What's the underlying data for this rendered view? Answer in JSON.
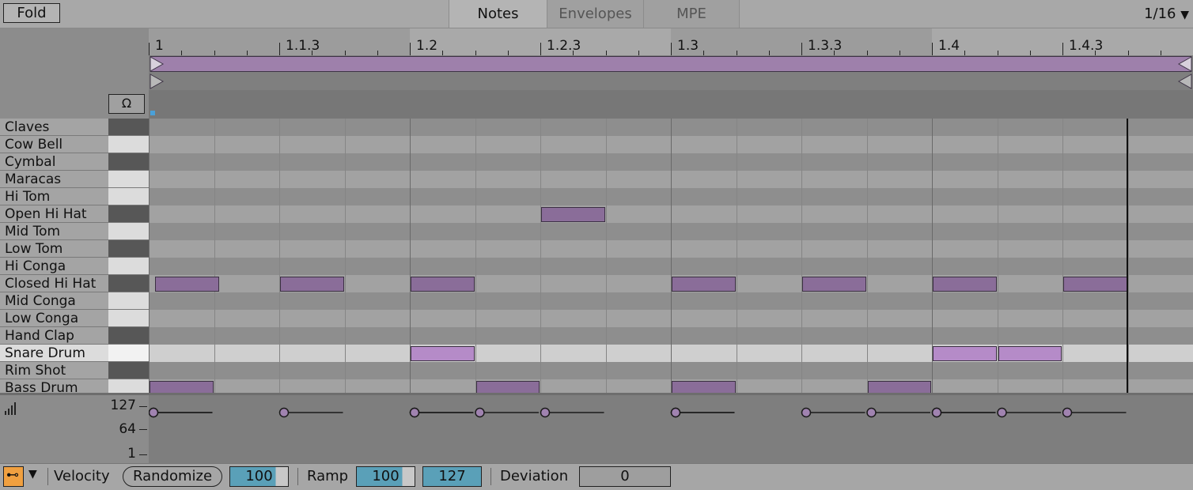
{
  "header": {
    "fold_label": "Fold",
    "tabs": [
      "Notes",
      "Envelopes",
      "MPE"
    ],
    "grid": "1/16"
  },
  "ruler": [
    "1",
    "1.1.3",
    "1.2",
    "1.2.3",
    "1.3",
    "1.3.3",
    "1.4",
    "1.4.3"
  ],
  "lanes": [
    "Claves",
    "Cow Bell",
    "Cymbal",
    "Maracas",
    "Hi Tom",
    "Open Hi Hat",
    "Mid Tom",
    "Low Tom",
    "Hi Conga",
    "Closed Hi Hat",
    "Mid Conga",
    "Low Conga",
    "Hand Clap",
    "Snare Drum",
    "Rim Shot",
    "Bass Drum"
  ],
  "selected_lane": "Snare Drum",
  "notes": [
    {
      "lane": "Open Hi Hat",
      "start": 1.5,
      "length": 0.25
    },
    {
      "lane": "Closed Hi Hat",
      "start": 0.0,
      "length": 0.25
    },
    {
      "lane": "Closed Hi Hat",
      "start": 0.5,
      "length": 0.25
    },
    {
      "lane": "Closed Hi Hat",
      "start": 1.0,
      "length": 0.25
    },
    {
      "lane": "Closed Hi Hat",
      "start": 2.0,
      "length": 0.25
    },
    {
      "lane": "Closed Hi Hat",
      "start": 2.5,
      "length": 0.25
    },
    {
      "lane": "Closed Hi Hat",
      "start": 3.0,
      "length": 0.25
    },
    {
      "lane": "Closed Hi Hat",
      "start": 3.5,
      "length": 0.25
    },
    {
      "lane": "Snare Drum",
      "start": 1.0,
      "length": 0.25,
      "selected": true
    },
    {
      "lane": "Snare Drum",
      "start": 3.0,
      "length": 0.25,
      "selected": true
    },
    {
      "lane": "Snare Drum",
      "start": 3.25,
      "length": 0.25,
      "selected": true
    },
    {
      "lane": "Bass Drum",
      "start": 0.0,
      "length": 0.25
    },
    {
      "lane": "Bass Drum",
      "start": 1.25,
      "length": 0.25
    },
    {
      "lane": "Bass Drum",
      "start": 2.0,
      "length": 0.25
    },
    {
      "lane": "Bass Drum",
      "start": 2.75,
      "length": 0.25
    }
  ],
  "velocity": {
    "labels": [
      "127",
      "64",
      "1"
    ],
    "icon": "velocity-bars-icon"
  },
  "bottom": {
    "velocity_label": "Velocity",
    "randomize_label": "Randomize",
    "velocity_value": "100",
    "ramp_label": "Ramp",
    "ramp_start": "100",
    "ramp_end": "127",
    "deviation_label": "Deviation",
    "deviation_value": "0"
  },
  "colors": {
    "note": "#8a6d99",
    "note_selected": "#b58bc8",
    "field_accent": "#5aa0b8",
    "edit_accent": "#f0a040"
  }
}
